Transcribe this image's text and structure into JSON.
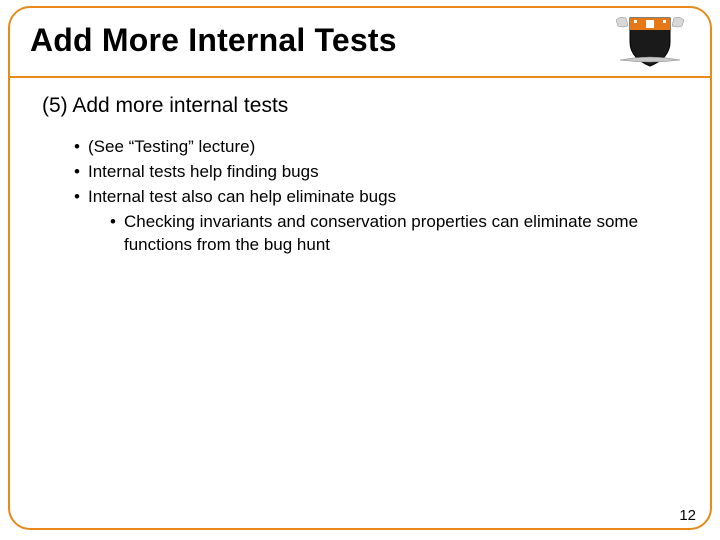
{
  "slide": {
    "title": "Add More Internal Tests",
    "section": "(5) Add more internal tests",
    "bullets": [
      {
        "text": "(See “Testing” lecture)"
      },
      {
        "text": "Internal tests help finding bugs"
      },
      {
        "text": "Internal test also can help eliminate bugs",
        "sub": [
          "Checking invariants and conservation properties can eliminate some functions from the bug hunt"
        ]
      }
    ],
    "page_number": "12"
  },
  "logo": {
    "name": "princeton-shield-logo"
  }
}
